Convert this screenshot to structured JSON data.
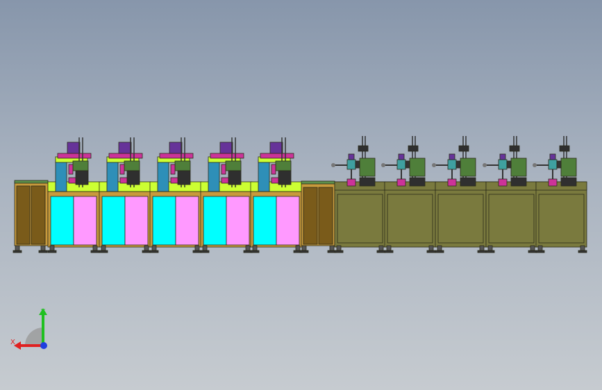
{
  "viewport": {
    "background_top": "#8796ab",
    "background_bottom": "#c6cbd0"
  },
  "colors": {
    "cabinet_tan": "#c89a3c",
    "cabinet_olive": "#7a7a3e",
    "door_dark_brown": "#7a5b1a",
    "panel_cyan": "#00ffff",
    "panel_pink": "#ff99ff",
    "deck_yellow_green": "#ccff33",
    "column_steel_blue": "#2e8fb8",
    "fixture_magenta": "#cc3399",
    "fixture_purple": "#663399",
    "fixture_green": "#4f7f3a",
    "fixture_gray": "#2f2f2f"
  },
  "line": {
    "left_section_modules": 5,
    "right_section_modules": 5,
    "left_end_cabinet": true,
    "middle_transfer_cabinet": true
  },
  "triad": {
    "x_label": "X",
    "y_label": "Y",
    "x_color": "#e02020",
    "y_color": "#20c020",
    "z_color": "#2040e0"
  }
}
